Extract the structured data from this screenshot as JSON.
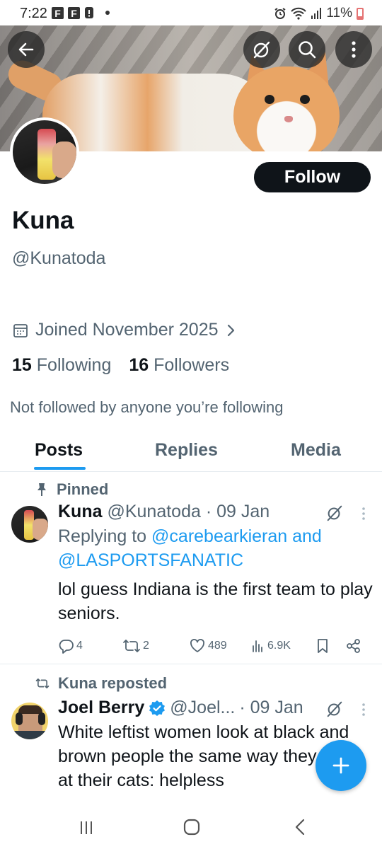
{
  "status_bar": {
    "time": "7:22",
    "battery": "11%",
    "left_icons": [
      "F",
      "F"
    ]
  },
  "profile": {
    "name": "Kuna",
    "handle": "@Kunatoda",
    "follow_label": "Follow",
    "joined": "Joined November 2025",
    "following_count": "15",
    "following_label": "Following",
    "followers_count": "16",
    "followers_label": "Followers",
    "not_followed": "Not followed by anyone you’re following"
  },
  "tabs": [
    {
      "label": "Posts",
      "active": true
    },
    {
      "label": "Replies",
      "active": false
    },
    {
      "label": "Media",
      "active": false
    }
  ],
  "posts": [
    {
      "context": "Pinned",
      "author": "Kuna",
      "handle": "@Kunatoda",
      "date": "· 09 Jan",
      "replying_prefix": "Replying to",
      "replying_to_1": "@carebearkieran",
      "replying_and": "and",
      "replying_to_2": "@LASPORTSFANATIC",
      "text": "lol guess Indiana is the first team to play seniors.",
      "replies": "4",
      "reposts": "2",
      "likes": "489",
      "views": "6.9K"
    },
    {
      "context": "Kuna reposted",
      "author": "Joel Berry",
      "handle": "@Joel...",
      "date": "· 09 Jan",
      "verified": true,
      "text": "White leftist women look at black and brown people the same way they look at their cats: helpless"
    }
  ],
  "colors": {
    "accent": "#1d9bf0",
    "text": "#0f1419",
    "muted": "#536471",
    "divider": "#e6ecf0"
  }
}
